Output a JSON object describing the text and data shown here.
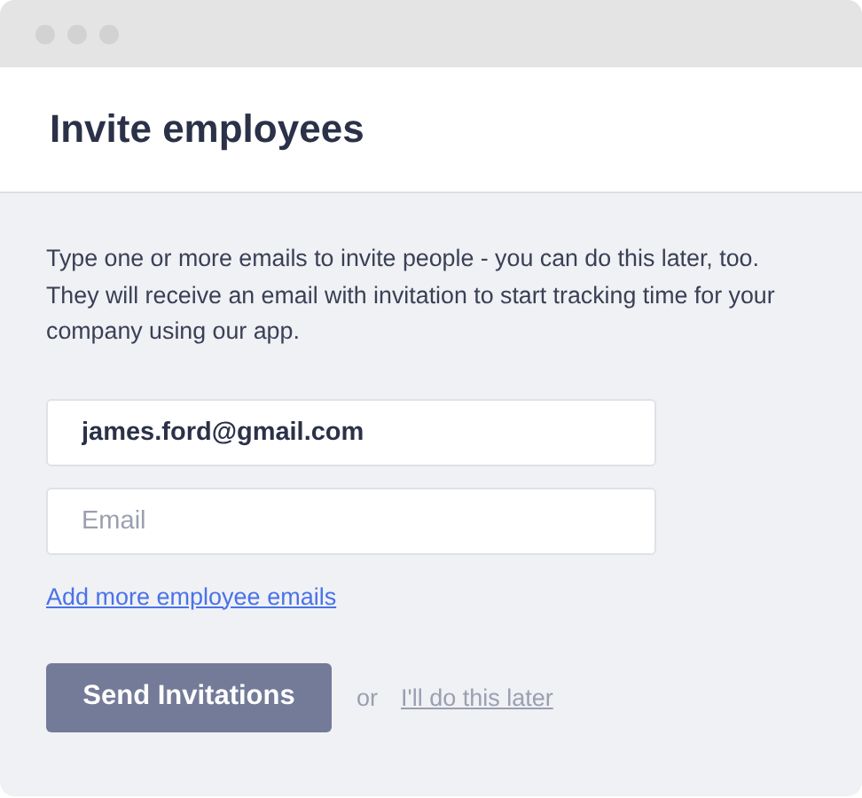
{
  "window": {
    "title": "Invite employees"
  },
  "description": "Type one or more emails to invite people - you can do this later, too. They will receive an email with invitation to start tracking time for your company using our app.",
  "email_fields": [
    {
      "value": "james.ford@gmail.com"
    },
    {
      "placeholder": "Email"
    }
  ],
  "add_more_link": "Add more employee emails",
  "send_button": "Send Invitations",
  "separator": "or",
  "skip_link": "I'll do this later"
}
